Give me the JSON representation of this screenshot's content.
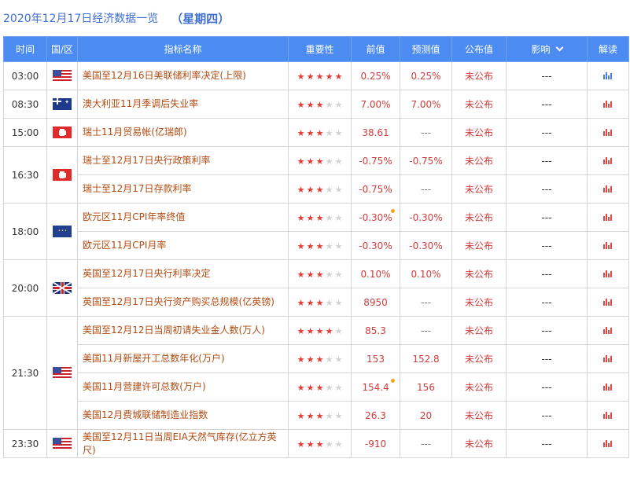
{
  "header": {
    "date": "2020年12月17日经济数据一览",
    "weekday": "（星期四）"
  },
  "columns": {
    "time": "时间",
    "region": "国/区",
    "indicator": "指标名称",
    "importance": "重要性",
    "previous": "前值",
    "forecast": "预测值",
    "actual": "公布值",
    "impact": "影响",
    "analysis": "解读"
  },
  "groups": [
    {
      "time": "03:00",
      "flag": "flag-us-icon",
      "rows": [
        {
          "name": "美国至12月16日美联储利率决定(上限)",
          "stars": 5,
          "previous": "0.25%",
          "forecast": "0.25%",
          "actual": "未公布",
          "impact": "---",
          "dot": false,
          "chart": "blue"
        }
      ]
    },
    {
      "time": "08:30",
      "flag": "flag-au-icon",
      "rows": [
        {
          "name": "澳大利亚11月季调后失业率",
          "stars": 3,
          "previous": "7.00%",
          "forecast": "7.00%",
          "actual": "未公布",
          "impact": "---",
          "dot": false,
          "chart": "red"
        }
      ]
    },
    {
      "time": "15:00",
      "flag": "flag-ch-icon",
      "rows": [
        {
          "name": "瑞士11月贸易帐(亿瑞郎)",
          "stars": 3,
          "previous": "38.61",
          "forecast": "---",
          "actual": "未公布",
          "impact": "---",
          "dot": false,
          "chart": "red"
        }
      ]
    },
    {
      "time": "16:30",
      "flag": "flag-ch-icon",
      "rows": [
        {
          "name": "瑞士至12月17日央行政策利率",
          "stars": 3,
          "previous": "-0.75%",
          "forecast": "-0.75%",
          "actual": "未公布",
          "impact": "---",
          "dot": false,
          "chart": "red"
        },
        {
          "name": "瑞士至12月17日存款利率",
          "stars": 3,
          "previous": "-0.75%",
          "forecast": "---",
          "actual": "未公布",
          "impact": "---",
          "dot": false,
          "chart": "red"
        }
      ]
    },
    {
      "time": "18:00",
      "flag": "flag-eu-icon",
      "rows": [
        {
          "name": "欧元区11月CPI年率终值",
          "stars": 3,
          "previous": "-0.30%",
          "forecast": "-0.30%",
          "actual": "未公布",
          "impact": "---",
          "dot": true,
          "chart": "red"
        },
        {
          "name": "欧元区11月CPI月率",
          "stars": 3,
          "previous": "-0.30%",
          "forecast": "-0.30%",
          "actual": "未公布",
          "impact": "---",
          "dot": false,
          "chart": "red"
        }
      ]
    },
    {
      "time": "20:00",
      "flag": "flag-gb-icon",
      "rows": [
        {
          "name": "英国至12月17日央行利率决定",
          "stars": 3,
          "previous": "0.10%",
          "forecast": "0.10%",
          "actual": "未公布",
          "impact": "---",
          "dot": false,
          "chart": "red"
        },
        {
          "name": "英国至12月17日央行资产购买总规模(亿英镑)",
          "stars": 3,
          "previous": "8950",
          "forecast": "---",
          "actual": "未公布",
          "impact": "---",
          "dot": false,
          "chart": "red"
        }
      ]
    },
    {
      "time": "21:30",
      "flag": "flag-us-icon",
      "rows": [
        {
          "name": "美国至12月12日当周初请失业金人数(万人)",
          "stars": 4,
          "previous": "85.3",
          "forecast": "---",
          "actual": "未公布",
          "impact": "---",
          "dot": false,
          "chart": "red"
        },
        {
          "name": "美国11月新屋开工总数年化(万户)",
          "stars": 3,
          "previous": "153",
          "forecast": "152.8",
          "actual": "未公布",
          "impact": "---",
          "dot": false,
          "chart": "red"
        },
        {
          "name": "美国11月营建许可总数(万户)",
          "stars": 3,
          "previous": "154.4",
          "forecast": "156",
          "actual": "未公布",
          "impact": "---",
          "dot": true,
          "chart": "red"
        },
        {
          "name": "美国12月费城联储制造业指数",
          "stars": 3,
          "previous": "26.3",
          "forecast": "20",
          "actual": "未公布",
          "impact": "---",
          "dot": false,
          "chart": "red"
        }
      ]
    },
    {
      "time": "23:30",
      "flag": "flag-us-icon",
      "rows": [
        {
          "name": "美国至12月11日当周EIA天然气库存(亿立方英尺)",
          "stars": 3,
          "previous": "-910",
          "forecast": "---",
          "actual": "未公布",
          "impact": "---",
          "dot": false,
          "chart": "red"
        }
      ]
    }
  ],
  "colors": {
    "header_bg": "#4c8cf2",
    "title": "#3f6dd1",
    "indicator_text": "#b24a10",
    "value_red": "#d23c3c",
    "star_on": "#e53935",
    "star_off": "#d2d2d2",
    "dot": "#f4a21a"
  }
}
